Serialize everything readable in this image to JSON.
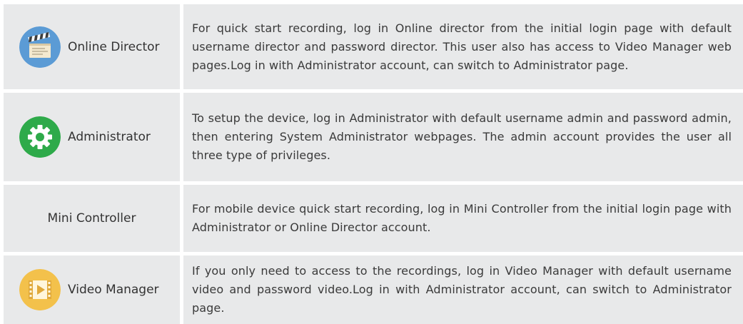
{
  "rows": [
    {
      "title": "Online Director",
      "icon": "clapperboard-icon",
      "description": "For quick start recording, log in Online director from the initial login page with default username director and password director. This user also has access to Video Manager web pages.Log in with Administrator account, can switch to Administrator page."
    },
    {
      "title": "Administrator",
      "icon": "gear-icon",
      "description": "To setup the device, log in Administrator with default username admin and password admin, then entering System Administrator webpages. The admin account provides the user all three type of privileges."
    },
    {
      "title": "Mini Controller",
      "icon": "",
      "description": "For mobile device quick start recording, log in Mini Controller from the initial login page with Administrator or Online Director account."
    },
    {
      "title": "Video Manager",
      "icon": "video-file-icon",
      "description": "If you only need to access to the recordings, log in Video Manager with default username video and password video.Log in with Administrator account, can switch to Administrator page."
    }
  ],
  "colors": {
    "cell_bg": "#e8e9ea",
    "director_icon_bg": "#5b9bd5",
    "admin_icon_bg": "#2eaa4a",
    "video_icon_bg": "#f3c14b"
  }
}
